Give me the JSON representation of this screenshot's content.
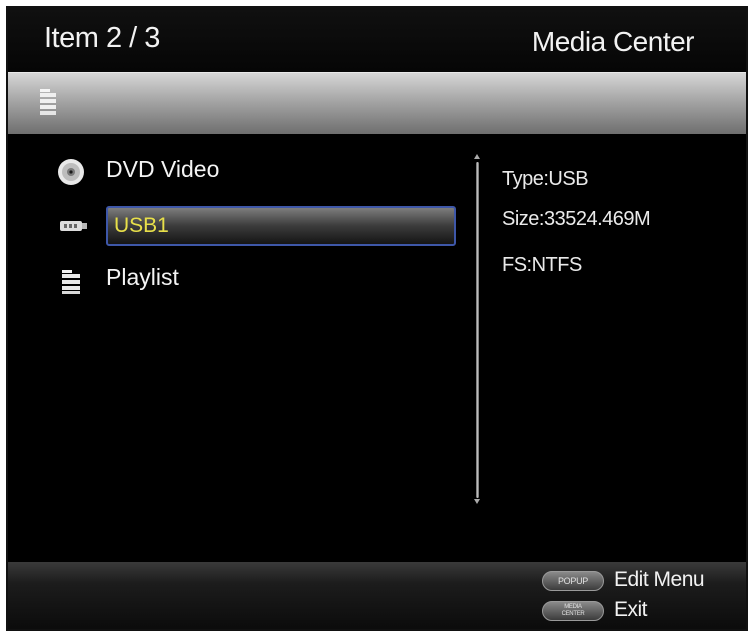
{
  "header": {
    "item_counter": "Item 2 / 3",
    "app_title": "Media Center"
  },
  "path_bar": {
    "icon": "folder-icon"
  },
  "file_list": {
    "items": [
      {
        "label": "DVD Video",
        "icon": "disc-icon",
        "selected": false
      },
      {
        "label": "USB1",
        "icon": "usb-icon",
        "selected": true
      },
      {
        "label": "Playlist",
        "icon": "folder-icon",
        "selected": false
      }
    ]
  },
  "details": {
    "type": "Type:USB",
    "size": "Size:33524.469M",
    "fs": "FS:NTFS"
  },
  "footer": {
    "hints": [
      {
        "button": "POPUP",
        "label": "Edit Menu"
      },
      {
        "button": "MEDIA CENTER",
        "button_line1": "MEDIA",
        "button_line2": "CENTER",
        "label": "Exit"
      }
    ]
  },
  "colors": {
    "background": "#000000",
    "selected_text": "#e8e04a",
    "selection_border": "#3e57a8",
    "text": "#f4f4f4"
  }
}
